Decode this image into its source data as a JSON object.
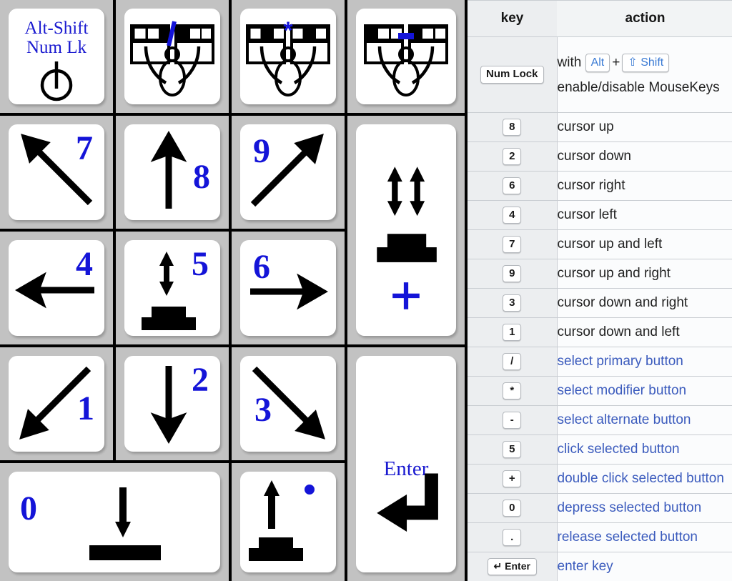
{
  "colors": {
    "key_blue": "#1414d8",
    "table_blue": "#3b5bbd",
    "chip_blue": "#3b7bd4",
    "cell_gray": "#c2c2c2",
    "key_white": "#ffffff",
    "grid_black": "#000000",
    "header_gray": "#eceef0"
  },
  "keypad": {
    "numlock_key": {
      "line1": "Alt-Shift",
      "line2": "Num Lk",
      "icon": "power-symbol-icon"
    },
    "mouse_keys": [
      {
        "symbol": "/",
        "icon": "two-mice-primary-button-icon",
        "highlight": "right-segment"
      },
      {
        "symbol": "*",
        "icon": "two-mice-modifier-button-icon",
        "highlight": "middle-segment"
      },
      {
        "symbol": "-",
        "icon": "two-mice-alternate-button-icon",
        "highlight": "left-segment"
      }
    ],
    "number_keys": [
      {
        "label": "7",
        "icon": "arrow-up-left-icon"
      },
      {
        "label": "8",
        "icon": "arrow-up-icon"
      },
      {
        "label": "9",
        "icon": "arrow-up-right-icon"
      },
      {
        "label": "4",
        "icon": "arrow-left-icon"
      },
      {
        "label": "5",
        "icon": "click-button-icon"
      },
      {
        "label": "6",
        "icon": "arrow-right-icon"
      },
      {
        "label": "1",
        "icon": "arrow-down-left-icon"
      },
      {
        "label": "2",
        "icon": "arrow-down-icon"
      },
      {
        "label": "3",
        "icon": "arrow-down-right-icon"
      },
      {
        "label": "0",
        "icon": "depress-button-icon"
      }
    ],
    "plus_key": {
      "label": "+",
      "icon": "double-click-button-icon"
    },
    "dot_key": {
      "label": ".",
      "icon": "release-button-icon"
    },
    "enter_key": {
      "label": "Enter",
      "icon": "return-arrow-icon"
    }
  },
  "table": {
    "headers": {
      "key": "key",
      "action": "action"
    },
    "numlock_row": {
      "key_chip": "Num Lock",
      "action_prefix": "with",
      "chip_alt": "Alt",
      "chip_plus": "+",
      "chip_shift": "⇧ Shift",
      "action_line2": "enable/disable MouseKeys"
    },
    "rows": [
      {
        "key": "8",
        "action": "cursor up",
        "blue": false
      },
      {
        "key": "2",
        "action": "cursor down",
        "blue": false
      },
      {
        "key": "6",
        "action": "cursor right",
        "blue": false
      },
      {
        "key": "4",
        "action": "cursor left",
        "blue": false
      },
      {
        "key": "7",
        "action": "cursor up and left",
        "blue": false
      },
      {
        "key": "9",
        "action": "cursor up and right",
        "blue": false
      },
      {
        "key": "3",
        "action": "cursor down and right",
        "blue": false
      },
      {
        "key": "1",
        "action": "cursor down and left",
        "blue": false
      },
      {
        "key": "/",
        "action": "select primary button",
        "blue": true
      },
      {
        "key": "*",
        "action": "select modifier button",
        "blue": true
      },
      {
        "key": "-",
        "action": "select alternate button",
        "blue": true
      },
      {
        "key": "5",
        "action": "click selected button",
        "blue": true
      },
      {
        "key": "+",
        "action": "double click selected button",
        "blue": true
      },
      {
        "key": "0",
        "action": "depress selected button",
        "blue": true
      },
      {
        "key": ".",
        "action": "release selected button",
        "blue": true
      },
      {
        "key": "↵ Enter",
        "action": "enter key",
        "blue": true
      }
    ]
  }
}
